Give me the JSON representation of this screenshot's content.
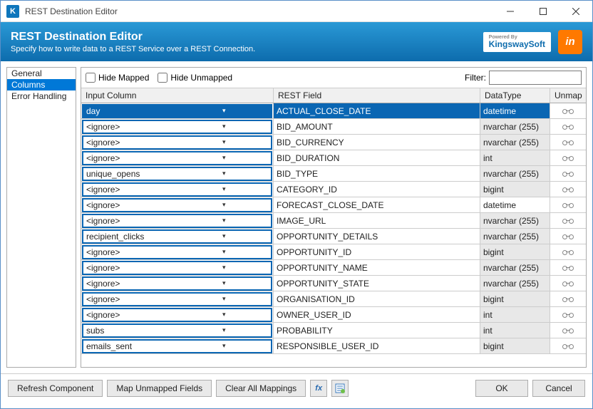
{
  "window": {
    "title": "REST Destination Editor"
  },
  "banner": {
    "title": "REST Destination Editor",
    "subtitle": "Specify how to write data to a REST Service over a REST Connection.",
    "poweredByLabel": "Powered By",
    "poweredByBrand": "KingswaySoft",
    "secondaryLogoText": "in"
  },
  "sidebar": {
    "items": [
      {
        "label": "General",
        "selected": false
      },
      {
        "label": "Columns",
        "selected": true
      },
      {
        "label": "Error Handling",
        "selected": false
      }
    ]
  },
  "toolbar": {
    "hideMappedLabel": "Hide Mapped",
    "hideUnmappedLabel": "Hide Unmapped",
    "filterLabel": "Filter:",
    "filterValue": ""
  },
  "gridHeaders": {
    "inputColumn": "Input Column",
    "restField": "REST Field",
    "dataType": "DataType",
    "unmap": "Unmap"
  },
  "rows": [
    {
      "input": "day",
      "rest": "ACTUAL_CLOSE_DATE",
      "type": "datetime",
      "typeShaded": true,
      "selected": true
    },
    {
      "input": "<ignore>",
      "rest": "BID_AMOUNT",
      "type": "nvarchar (255)",
      "typeShaded": true,
      "selected": false
    },
    {
      "input": "<ignore>",
      "rest": "BID_CURRENCY",
      "type": "nvarchar (255)",
      "typeShaded": true,
      "selected": false
    },
    {
      "input": "<ignore>",
      "rest": "BID_DURATION",
      "type": "int",
      "typeShaded": true,
      "selected": false
    },
    {
      "input": "unique_opens",
      "rest": "BID_TYPE",
      "type": "nvarchar (255)",
      "typeShaded": true,
      "selected": false
    },
    {
      "input": "<ignore>",
      "rest": "CATEGORY_ID",
      "type": "bigint",
      "typeShaded": true,
      "selected": false
    },
    {
      "input": "<ignore>",
      "rest": "FORECAST_CLOSE_DATE",
      "type": "datetime",
      "typeShaded": false,
      "selected": false
    },
    {
      "input": "<ignore>",
      "rest": "IMAGE_URL",
      "type": "nvarchar (255)",
      "typeShaded": true,
      "selected": false
    },
    {
      "input": "recipient_clicks",
      "rest": "OPPORTUNITY_DETAILS",
      "type": "nvarchar (255)",
      "typeShaded": true,
      "selected": false
    },
    {
      "input": "<ignore>",
      "rest": "OPPORTUNITY_ID",
      "type": "bigint",
      "typeShaded": true,
      "selected": false
    },
    {
      "input": "<ignore>",
      "rest": "OPPORTUNITY_NAME",
      "type": "nvarchar (255)",
      "typeShaded": true,
      "selected": false
    },
    {
      "input": "<ignore>",
      "rest": "OPPORTUNITY_STATE",
      "type": "nvarchar (255)",
      "typeShaded": true,
      "selected": false
    },
    {
      "input": "<ignore>",
      "rest": "ORGANISATION_ID",
      "type": "bigint",
      "typeShaded": true,
      "selected": false
    },
    {
      "input": "<ignore>",
      "rest": "OWNER_USER_ID",
      "type": "int",
      "typeShaded": true,
      "selected": false
    },
    {
      "input": "subs",
      "rest": "PROBABILITY",
      "type": "int",
      "typeShaded": true,
      "selected": false
    },
    {
      "input": "emails_sent",
      "rest": "RESPONSIBLE_USER_ID",
      "type": "bigint",
      "typeShaded": true,
      "selected": false
    }
  ],
  "footer": {
    "refresh": "Refresh Component",
    "mapUnmapped": "Map Unmapped Fields",
    "clearAll": "Clear All Mappings",
    "ok": "OK",
    "cancel": "Cancel"
  }
}
